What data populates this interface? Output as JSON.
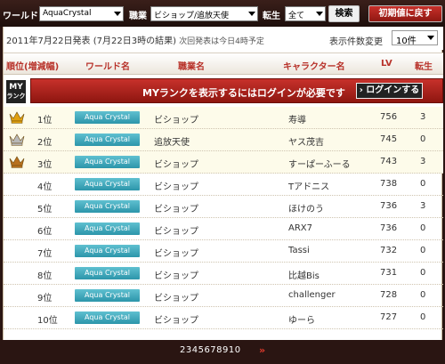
{
  "topbar": {
    "world_label": "ワールド",
    "world_value": "AquaCrystal",
    "job_label": "職業",
    "job_value": "ビショップ/追放天使",
    "rebirth_label": "転生",
    "rebirth_value": "全て",
    "search_label": "検索",
    "reset_label": "初期値に戻す"
  },
  "info": {
    "release": "2011年7月22日発表 (7月22日3時の結果)",
    "next": "次回発表は今日4時予定",
    "count_label": "表示件数変更",
    "count_value": "10件"
  },
  "headers": {
    "rank": "順位(増減幅)",
    "world": "ワールド名",
    "job": "職業名",
    "character": "キャラクター名",
    "lv": "LV",
    "rebirth": "転生"
  },
  "myrank": {
    "label_top": "MY",
    "label_bottom": "ランク",
    "message": "MYランクを表示するにはログインが必要です",
    "login_label": "ログインする"
  },
  "rows": [
    {
      "rank": "1位",
      "crown": "gold-crown-icon",
      "world": "Aqua Crystal",
      "job": "ビショップ",
      "name": "寿導",
      "lv": "756",
      "rebirth": "3"
    },
    {
      "rank": "2位",
      "crown": "silver-crown-icon",
      "world": "Aqua Crystal",
      "job": "追放天使",
      "name": "ヤス茂吉",
      "lv": "745",
      "rebirth": "0"
    },
    {
      "rank": "3位",
      "crown": "bronze-crown-icon",
      "world": "Aqua Crystal",
      "job": "ビショップ",
      "name": "すーぱーふーる",
      "lv": "743",
      "rebirth": "3"
    },
    {
      "rank": "4位",
      "crown": "",
      "world": "Aqua Crystal",
      "job": "ビショップ",
      "name": "Tアドニス",
      "lv": "738",
      "rebirth": "0"
    },
    {
      "rank": "5位",
      "crown": "",
      "world": "Aqua Crystal",
      "job": "ビショップ",
      "name": "ほけのう",
      "lv": "736",
      "rebirth": "3"
    },
    {
      "rank": "6位",
      "crown": "",
      "world": "Aqua Crystal",
      "job": "ビショップ",
      "name": "ARX7",
      "lv": "736",
      "rebirth": "0"
    },
    {
      "rank": "7位",
      "crown": "",
      "world": "Aqua Crystal",
      "job": "ビショップ",
      "name": "Tassi",
      "lv": "732",
      "rebirth": "0"
    },
    {
      "rank": "8位",
      "crown": "",
      "world": "Aqua Crystal",
      "job": "ビショップ",
      "name": "比越Bis",
      "lv": "731",
      "rebirth": "0"
    },
    {
      "rank": "9位",
      "crown": "",
      "world": "Aqua Crystal",
      "job": "ビショップ",
      "name": "challenger",
      "lv": "728",
      "rebirth": "0"
    },
    {
      "rank": "10位",
      "crown": "",
      "world": "Aqua Crystal",
      "job": "ビショップ",
      "name": "ゆーら",
      "lv": "727",
      "rebirth": "0"
    }
  ],
  "pager": {
    "pages": "2345678910",
    "next": "»"
  },
  "colors": {
    "accent": "#b8322a",
    "banner": "#c7312b",
    "badge": "#2c95aa",
    "gold": "#e0a010",
    "silver": "#b8b8b8",
    "bronze": "#b8701e"
  }
}
